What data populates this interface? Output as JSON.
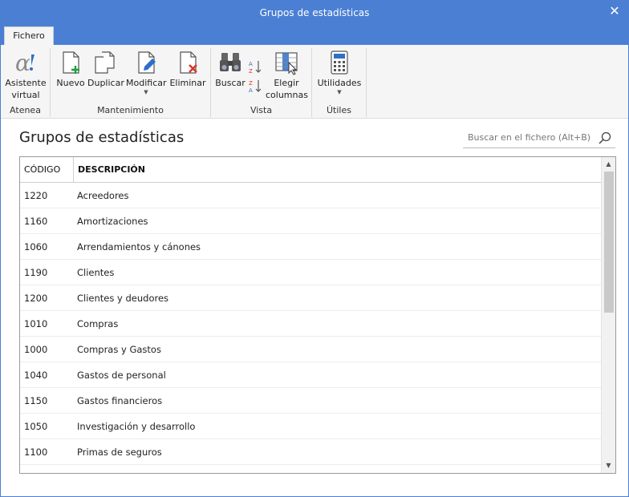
{
  "window": {
    "title": "Grupos de estadísticas"
  },
  "tabs": [
    {
      "label": "Fichero"
    }
  ],
  "ribbon": {
    "groups": [
      {
        "label": "Atenea",
        "buttons": [
          {
            "label": "Asistente virtual",
            "icon": "alpha-icon"
          }
        ]
      },
      {
        "label": "Mantenimiento",
        "buttons": [
          {
            "label": "Nuevo",
            "icon": "new-document-icon"
          },
          {
            "label": "Duplicar",
            "icon": "duplicate-icon"
          },
          {
            "label": "Modificar",
            "icon": "edit-document-icon"
          },
          {
            "label": "Eliminar",
            "icon": "delete-document-icon"
          }
        ]
      },
      {
        "label": "Vista",
        "buttons": [
          {
            "label": "Buscar",
            "icon": "binoculars-icon"
          },
          {
            "label": "",
            "icon": "sort-az-icon"
          },
          {
            "label": "",
            "icon": "sort-za-icon"
          },
          {
            "label": "Elegir columnas",
            "icon": "columns-icon"
          }
        ]
      },
      {
        "label": "Útiles",
        "buttons": [
          {
            "label": "Utilidades",
            "icon": "calculator-icon"
          }
        ]
      }
    ]
  },
  "page": {
    "title": "Grupos de estadísticas"
  },
  "search": {
    "placeholder": "Buscar en el fichero (Alt+B)"
  },
  "grid": {
    "columns": [
      "CÓDIGO",
      "DESCRIPCIÓN"
    ],
    "rows": [
      {
        "code": "1220",
        "description": "Acreedores"
      },
      {
        "code": "1160",
        "description": "Amortizaciones"
      },
      {
        "code": "1060",
        "description": "Arrendamientos y cánones"
      },
      {
        "code": "1190",
        "description": "Clientes"
      },
      {
        "code": "1200",
        "description": "Clientes y deudores"
      },
      {
        "code": "1010",
        "description": "Compras"
      },
      {
        "code": "1000",
        "description": "Compras y Gastos"
      },
      {
        "code": "1040",
        "description": "Gastos de personal"
      },
      {
        "code": "1150",
        "description": "Gastos financieros"
      },
      {
        "code": "1050",
        "description": "Investigación y desarrollo"
      },
      {
        "code": "1100",
        "description": "Primas de seguros"
      }
    ]
  },
  "colors": {
    "accent": "#4a7fd4",
    "ribbon_bg": "#f5f5f5",
    "delete_red": "#d9342b",
    "new_green": "#1e9e3a",
    "icon_blue": "#2e6fc7"
  }
}
